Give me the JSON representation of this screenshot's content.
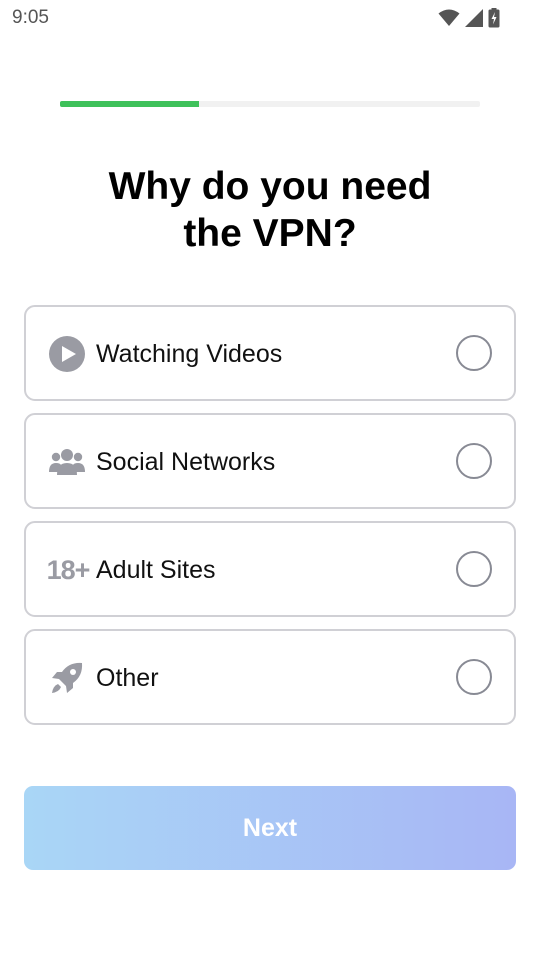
{
  "status_bar": {
    "time": "9:05",
    "icons": [
      "wifi-icon",
      "signal-icon",
      "battery-charging-icon"
    ]
  },
  "progress": {
    "fraction": 0.33,
    "color": "#3ec15a"
  },
  "title": {
    "line1": "Why do you need",
    "line2": "the VPN?"
  },
  "options": [
    {
      "label": "Watching Videos",
      "icon": "play-icon",
      "selected": false
    },
    {
      "label": "Social Networks",
      "icon": "people-icon",
      "selected": false
    },
    {
      "label": "Adult Sites",
      "icon": "eighteen-plus-icon",
      "icon_text": "18+",
      "selected": false
    },
    {
      "label": "Other",
      "icon": "rocket-icon",
      "selected": false
    }
  ],
  "next_button": {
    "label": "Next"
  },
  "colors": {
    "icon_gray": "#9a9ba3",
    "border": "#d0d0d5",
    "radio": "#888a94"
  }
}
